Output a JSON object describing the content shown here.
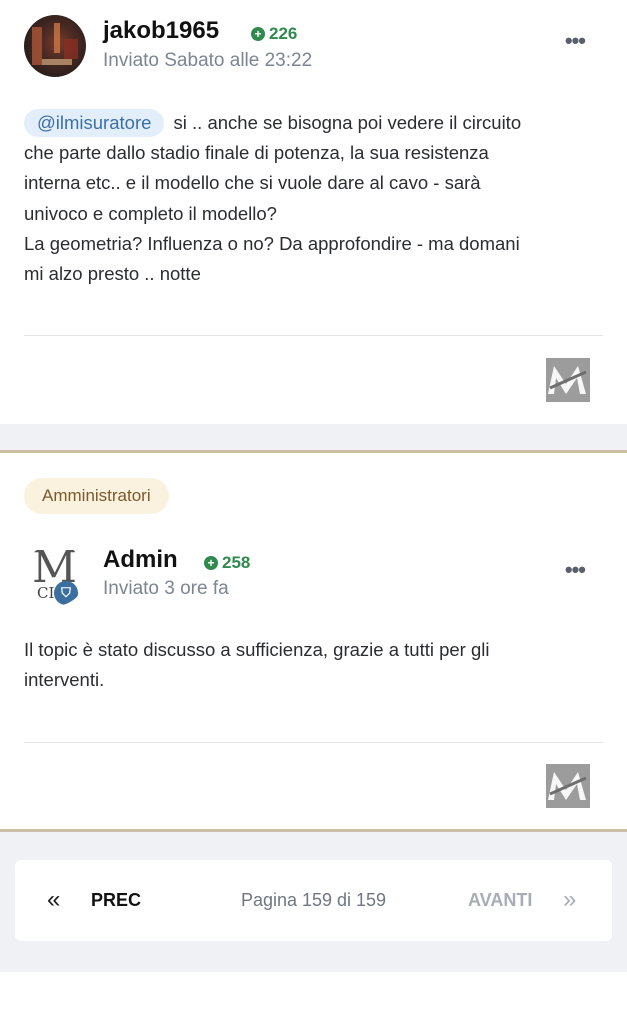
{
  "posts": [
    {
      "author": "jakob1965",
      "reputation": "226",
      "posted": "Inviato Sabato alle 23:22",
      "mention": "@ilmisuratore",
      "lines": [
        "si .. anche se bisogna poi vedere il circuito",
        "che parte dallo stadio finale di potenza, la sua resistenza",
        "interna etc..  e il modello che si vuole dare al cavo - sarà",
        "univoco e completo il modello?",
        "La geometria? Influenza o no? Da approfondire - ma domani",
        "mi alzo presto .. notte"
      ],
      "more_icon": "more-dots-icon"
    },
    {
      "role": "Amministratori",
      "author": "Admin",
      "reputation": "258",
      "posted": "Inviato 3 ore fa",
      "avatar_text": {
        "m": "M",
        "ci": "CI"
      },
      "lines": [
        "Il topic è stato discusso a sufficienza, grazie a tutti per gli",
        "interventi."
      ],
      "more_icon": "more-dots-icon"
    }
  ],
  "pagination": {
    "prev_label": "PREC",
    "page_info": "Pagina 159 di 159",
    "next_label": "AVANTI",
    "prev_icon": "double-chevron-left-icon",
    "next_icon": "double-chevron-right-icon"
  },
  "colors": {
    "reputation": "#2f8a4e",
    "mention_bg": "#e3eefb",
    "role_badge_bg": "#fbf1df",
    "separator": "#cbbfa6"
  }
}
